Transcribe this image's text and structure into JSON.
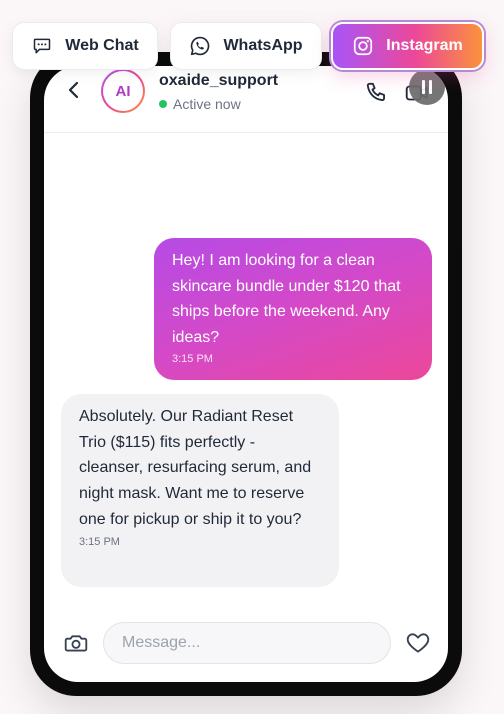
{
  "tabs": {
    "web_chat": "Web Chat",
    "whatsapp": "WhatsApp",
    "instagram": "Instagram",
    "active": "instagram"
  },
  "header": {
    "avatar_initials": "AI",
    "name": "oxaide_support",
    "status": "Active now",
    "status_color": "#22c55e"
  },
  "messages": [
    {
      "sender": "user",
      "text": "Hey! I am looking for a clean skincare bundle under $120 that ships before the weekend. Any ideas?",
      "time": "3:15 PM"
    },
    {
      "sender": "assistant",
      "text": "Absolutely. Our Radiant Reset Trio ($115) fits perfectly - cleanser, resurfacing serum, and night mask. Want me to reserve one for pickup or ship it to you?",
      "time": "3:15 PM"
    }
  ],
  "composer": {
    "placeholder": "Message...",
    "value": ""
  },
  "icons": {
    "back": "chevron-left-icon",
    "call": "phone-icon",
    "video": "video-icon",
    "pause": "pause-icon",
    "camera": "camera-icon",
    "like": "heart-icon",
    "web_chat": "chat-bubble-icon",
    "whatsapp": "whatsapp-icon",
    "instagram": "instagram-icon"
  },
  "colors": {
    "accent_start": "#a855f7",
    "accent_mid": "#ec4899",
    "accent_end": "#fb923c",
    "incoming_bubble": "#f2f2f4"
  }
}
